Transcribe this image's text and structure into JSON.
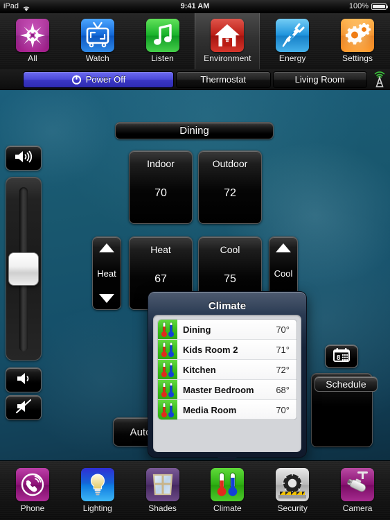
{
  "status_bar": {
    "device": "iPad",
    "wifi_icon": "wifi-icon",
    "time": "9:41 AM",
    "battery_percent": "100%",
    "battery_icon": "battery-icon"
  },
  "top_toolbar": {
    "items": [
      {
        "label": "All",
        "icon": "compass-star-icon",
        "selected": false
      },
      {
        "label": "Watch",
        "icon": "television-icon",
        "selected": false
      },
      {
        "label": "Listen",
        "icon": "music-note-icon",
        "selected": false
      },
      {
        "label": "Environment",
        "icon": "house-bulb-icon",
        "selected": true
      },
      {
        "label": "Energy",
        "icon": "power-plug-icon",
        "selected": false
      },
      {
        "label": "Settings",
        "icon": "gears-icon",
        "selected": false
      }
    ]
  },
  "sub_toolbar": {
    "power_label": "Power Off",
    "power_icon": "power-icon",
    "thermostat_label": "Thermostat",
    "room_label": "Living Room",
    "antenna_icon": "antenna-broadcast-icon"
  },
  "volume": {
    "up_icon": "volume-up-icon",
    "down_icon": "volume-down-icon",
    "mute_icon": "volume-mute-icon",
    "slider_position_percent": 55
  },
  "thermostat": {
    "zone_title": "Dining",
    "indoor": {
      "label": "Indoor",
      "value": "70"
    },
    "outdoor": {
      "label": "Outdoor",
      "value": "72"
    },
    "heat_stepper": {
      "label": "Heat",
      "up_icon": "triangle-up-icon",
      "down_icon": "triangle-down-icon"
    },
    "cool_stepper": {
      "label": "Cool",
      "up_icon": "triangle-up-icon",
      "down_icon": "triangle-down-icon"
    },
    "heat_setpoint": {
      "label": "Heat",
      "value": "67"
    },
    "cool_setpoint": {
      "label": "Cool",
      "value": "75"
    },
    "mode_label": "Auto"
  },
  "schedule": {
    "calendar_icon": "calendar-icon",
    "calendar_day": "8",
    "title": "Schedule"
  },
  "popover": {
    "title": "Climate",
    "rows": [
      {
        "icon": "thermometer-icon",
        "room": "Dining",
        "temp": "70°"
      },
      {
        "icon": "thermometer-icon",
        "room": "Kids Room 2",
        "temp": "71°"
      },
      {
        "icon": "thermometer-icon",
        "room": "Kitchen",
        "temp": "72°"
      },
      {
        "icon": "thermometer-icon",
        "room": "Master Bedroom",
        "temp": "68°"
      },
      {
        "icon": "thermometer-icon",
        "room": "Media Room",
        "temp": "70°"
      }
    ]
  },
  "tab_bar": {
    "items": [
      {
        "label": "Phone",
        "icon": "phone-icon",
        "selected": false
      },
      {
        "label": "Lighting",
        "icon": "lightbulb-icon",
        "selected": false
      },
      {
        "label": "Shades",
        "icon": "window-shade-icon",
        "selected": false
      },
      {
        "label": "Climate",
        "icon": "thermometer-icon",
        "selected": true
      },
      {
        "label": "Security",
        "icon": "safe-dial-icon",
        "selected": false
      },
      {
        "label": "Camera",
        "icon": "cctv-camera-icon",
        "selected": false
      }
    ]
  },
  "colors": {
    "accent_power": "#4b49d8",
    "background_teal": "#15506a",
    "popover_navy": "#16243a",
    "climate_green": "#3bbf1c"
  }
}
